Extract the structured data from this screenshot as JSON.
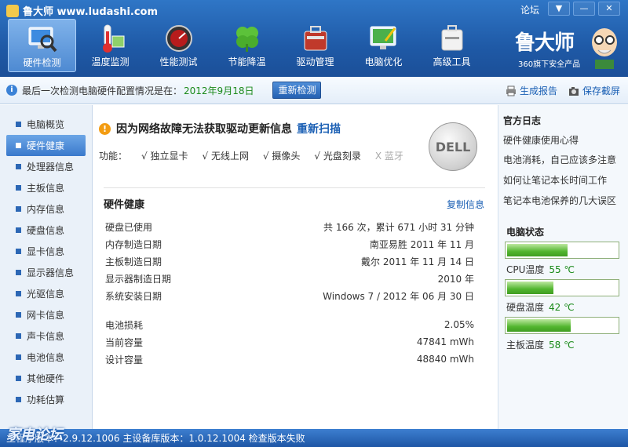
{
  "app": {
    "title": "鲁大师 www.ludashi.com",
    "forum": "论坛"
  },
  "window": {
    "dropdown": "▼",
    "minimize": "—",
    "close": "✕"
  },
  "nav": [
    {
      "label": "硬件检测",
      "icon": "monitor-magnifier-icon",
      "active": true
    },
    {
      "label": "温度监测",
      "icon": "thermometer-icon",
      "active": false
    },
    {
      "label": "性能测试",
      "icon": "speedometer-icon",
      "active": false
    },
    {
      "label": "节能降温",
      "icon": "clover-icon",
      "active": false
    },
    {
      "label": "驱动管理",
      "icon": "toolbox-icon",
      "active": false
    },
    {
      "label": "电脑优化",
      "icon": "monitor-brush-icon",
      "active": false
    },
    {
      "label": "高级工具",
      "icon": "tool-case-icon",
      "active": false
    }
  ],
  "brand": {
    "title": "鲁大师",
    "subtitle": "360旗下安全产品"
  },
  "infobar": {
    "text": "最后一次检测电脑硬件配置情况是在：",
    "date": "2012年9月18日",
    "recheck": "重新检测",
    "report": "生成报告",
    "screenshot": "保存截屏"
  },
  "sidebar": {
    "items": [
      "电脑概览",
      "硬件健康",
      "处理器信息",
      "主板信息",
      "内存信息",
      "硬盘信息",
      "显卡信息",
      "显示器信息",
      "光驱信息",
      "网卡信息",
      "声卡信息",
      "电池信息",
      "其他硬件",
      "功耗估算"
    ],
    "active": 1
  },
  "main": {
    "warning": "因为网络故障无法获取驱动更新信息",
    "rescan": "重新扫描",
    "features_label": "功能：",
    "features": [
      {
        "text": "√ 独立显卡",
        "enabled": true
      },
      {
        "text": "√ 无线上网",
        "enabled": true
      },
      {
        "text": "√ 摄像头",
        "enabled": true
      },
      {
        "text": "√ 光盘刻录",
        "enabled": true
      },
      {
        "text": "X 蓝牙",
        "enabled": false
      }
    ],
    "brand_logo": "DELL",
    "section_title": "硬件健康",
    "copy": "复制信息",
    "rows1": [
      {
        "label": "硬盘已使用",
        "value": "共 166 次，累计 671 小时 31 分钟"
      },
      {
        "label": "内存制造日期",
        "value": "南亚易胜 2011 年 11 月"
      },
      {
        "label": "主板制造日期",
        "value": "戴尔 2011 年 11 月 14 日"
      },
      {
        "label": "显示器制造日期",
        "value": "2010 年"
      },
      {
        "label": "系统安装日期",
        "value": "Windows 7 / 2012 年 06 月 30 日"
      }
    ],
    "rows2": [
      {
        "label": "电池损耗",
        "value": "2.05%"
      },
      {
        "label": "当前容量",
        "value": "47841 mWh"
      },
      {
        "label": "设计容量",
        "value": "48840 mWh"
      }
    ]
  },
  "right": {
    "log_title": "官方日志",
    "links": [
      "硬件健康使用心得",
      "电池消耗，自己应该多注意",
      "如何让笔记本长时间工作",
      "笔记本电池保养的几大误区"
    ],
    "status_title": "电脑状态",
    "temps": [
      {
        "label": "CPU温度",
        "value": "55 ℃",
        "level": 0.55
      },
      {
        "label": "硬盘温度",
        "value": "42 ℃",
        "level": 0.42
      },
      {
        "label": "主板温度",
        "value": "58 ℃",
        "level": 0.58
      }
    ]
  },
  "statusbar": {
    "text": "主程序版本：2.9.12.1006   主设备库版本：1.0.12.1004   检查版本失败",
    "watermark": "家电论坛"
  },
  "colors": {
    "accent": "#1f5aa7",
    "temp_green": "#52b62f",
    "link": "#1a5fb4"
  }
}
